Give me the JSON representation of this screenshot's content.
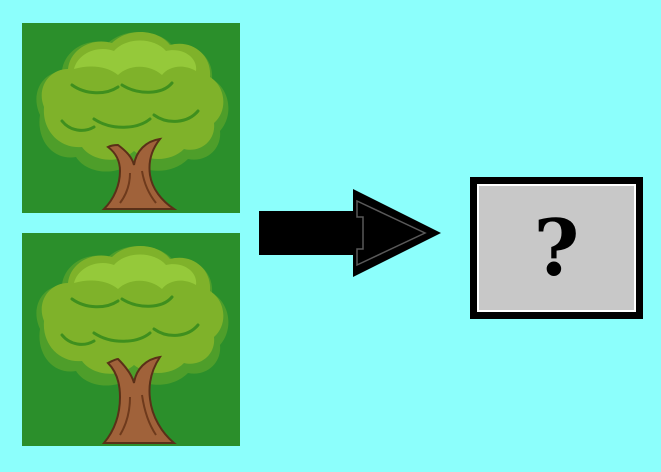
{
  "scene": {
    "background_color": "#8cfffc",
    "tile_background_color": "#2b8f2b",
    "tiles": [
      {
        "icon": "tree-icon"
      },
      {
        "icon": "tree-icon"
      }
    ],
    "arrow": {
      "icon": "right-arrow-icon",
      "color": "#000000"
    },
    "answer": {
      "mark": "?",
      "box_color": "#c8c8c8",
      "border_color": "#000000"
    }
  }
}
